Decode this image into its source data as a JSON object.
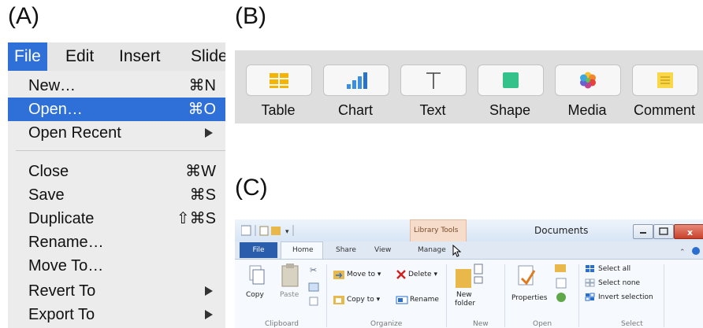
{
  "panel_labels": {
    "a": "(A)",
    "b": "(B)",
    "c": "(C)"
  },
  "menu_bar": [
    "File",
    "Edit",
    "Insert",
    "Slide"
  ],
  "menu_items": [
    {
      "label": "New…",
      "shortcut": "⌘N"
    },
    {
      "label": "Open…",
      "shortcut": "⌘O"
    },
    {
      "label": "Open Recent",
      "shortcut": ""
    },
    {
      "label": "Close",
      "shortcut": "⌘W"
    },
    {
      "label": "Save",
      "shortcut": "⌘S"
    },
    {
      "label": "Duplicate",
      "shortcut": "⇧⌘S"
    },
    {
      "label": "Rename…",
      "shortcut": ""
    },
    {
      "label": "Move To…",
      "shortcut": ""
    },
    {
      "label": "Revert To",
      "shortcut": ""
    },
    {
      "label": "Export To",
      "shortcut": ""
    }
  ],
  "toolbar_b": {
    "buttons": [
      "Table",
      "Chart",
      "Text",
      "Shape",
      "Media",
      "Comment"
    ]
  },
  "explorer": {
    "title": "Documents",
    "contextual_tab": "Library Tools",
    "tabs": [
      "File",
      "Home",
      "Share",
      "View",
      "Manage"
    ],
    "commands": {
      "copy": "Copy",
      "paste": "Paste",
      "move_to": "Move to",
      "copy_to": "Copy to",
      "delete": "Delete",
      "rename": "Rename",
      "new_folder_1": "New",
      "new_folder_2": "folder",
      "properties": "Properties",
      "select_all": "Select all",
      "select_none": "Select none",
      "invert_selection": "Invert selection"
    },
    "groups": [
      "Clipboard",
      "Organize",
      "New",
      "Open",
      "Select"
    ]
  },
  "colors": {
    "accent": "#2f6fd8",
    "ribbon_file": "#2a5dab"
  }
}
